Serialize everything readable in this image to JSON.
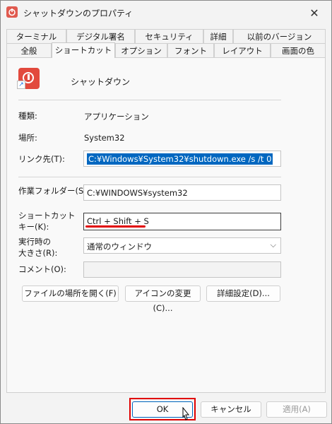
{
  "window": {
    "title": "シャットダウンのプロパティ"
  },
  "tabs_row1": [
    "ターミナル",
    "デジタル署名",
    "セキュリティ",
    "詳細",
    "以前のバージョン"
  ],
  "tabs_row2": [
    "全般",
    "ショートカット",
    "オプション",
    "フォント",
    "レイアウト",
    "画面の色"
  ],
  "active_tab": "ショートカット",
  "shortcut": {
    "name": "シャットダウン"
  },
  "fields": {
    "type_label": "種類:",
    "type_value": "アプリケーション",
    "location_label": "場所:",
    "location_value": "System32",
    "target_label": "リンク先(T):",
    "target_value": "C:¥Windows¥System32¥shutdown.exe /s /t 0",
    "startin_label": "作業フォルダー(S):",
    "startin_value": "C:¥WINDOWS¥system32",
    "hotkey_label_1": "ショートカット",
    "hotkey_label_2": "キー(K):",
    "hotkey_value": "Ctrl + Shift + S",
    "run_label_1": "実行時の",
    "run_label_2": "大きさ(R):",
    "run_value": "通常のウィンドウ",
    "comment_label": "コメント(O):",
    "comment_value": ""
  },
  "buttons": {
    "open_location": "ファイルの場所を開く(F)",
    "change_icon": "アイコンの変更(C)...",
    "advanced": "詳細設定(D)..."
  },
  "footer": {
    "ok": "OK",
    "cancel": "キャンセル",
    "apply": "適用(A)"
  },
  "colors": {
    "selection": "#0067c0",
    "annotation_red": "#e00000",
    "icon_red": "#e2493d"
  }
}
